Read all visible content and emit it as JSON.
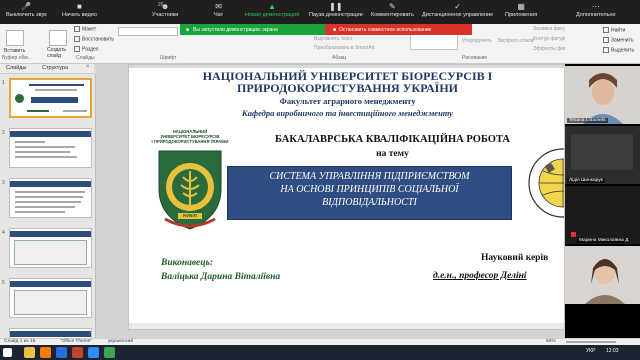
{
  "colors": {
    "zoom_bar": "#1f1f1f",
    "share_green": "#1aa33a",
    "share_red": "#d9322a",
    "slide_title_blue": "#1f3864",
    "topic_box": "#2f4d82",
    "executor_green": "#1f5d2c",
    "thumb_selected": "#e8a33b"
  },
  "zoom_toolbar": {
    "items": [
      {
        "label": "Выключить звук",
        "icon": "microphone-icon"
      },
      {
        "label": "Начать видео",
        "icon": "video-off-icon"
      },
      {
        "label": "Участники",
        "icon": "participants-icon"
      },
      {
        "label": "Чат",
        "icon": "chat-icon"
      },
      {
        "label": "Новая демонстрация",
        "icon": "share-screen-icon"
      },
      {
        "label": "Пауза демонстрации",
        "icon": "pause-icon"
      },
      {
        "label": "Комментировать",
        "icon": "annotate-icon"
      },
      {
        "label": "Дистанционное управление",
        "icon": "remote-control-icon"
      },
      {
        "label": "Приложения",
        "icon": "apps-icon"
      },
      {
        "label": "Дополнительно",
        "icon": "more-icon"
      }
    ],
    "participant_count": "26"
  },
  "share_banner": {
    "sharing_text": "Вы запустили демонстрацию экрана",
    "stop_text": "Остановить совместное использование"
  },
  "ribbon": {
    "clipboard": {
      "paste": "Вставить",
      "group": "Буфер обм..."
    },
    "slides": {
      "create": "Создать слайд",
      "layout": "Макет",
      "reset": "Восстановить",
      "section": "Раздел",
      "group": "Слайды"
    },
    "font": {
      "group": "Шрифт"
    },
    "paragraph": {
      "group": "Абзац",
      "text_direction": "Направление текста",
      "align_text": "Выровнять текст",
      "smartart": "Преобразовать в SmartArt"
    },
    "drawing": {
      "group": "Рисование",
      "arrange": "Упорядочить",
      "quick_styles": "Экспресс-стили"
    },
    "editing": {
      "find": "Найти",
      "replace": "Заменить",
      "select": "Выделить",
      "shape_fill": "Заливка фигуры",
      "shape_outline": "Контур фигуры",
      "shape_effects": "Эффекты фигуры"
    }
  },
  "panes": {
    "tab_slides": "Слайды",
    "tab_outline": "Структура",
    "close": "×",
    "slide_numbers": [
      "1",
      "2",
      "3",
      "4",
      "5"
    ]
  },
  "slide": {
    "university_line1": "НАЦІОНАЛЬНИЙ УНІВЕРСИТЕТ БІОРЕСУРСІВ І",
    "university_line2": "ПРИРОДОКОРИСТУВАННЯ УКРАЇНИ",
    "faculty": "Факультет аграрного менеджменту",
    "department": "Кафедра виробничого та інвестиційного  менеджменту",
    "work_type": "БАКАЛАВРСЬКА КВАЛІФІКАЦІЙНА РОБОТА",
    "on_topic": "на тему",
    "topic_line1": "СИСТЕМА УПРАВЛІННЯ ПІДПРИЄМСТВОМ",
    "topic_line2": "НА ОСНОВІ ПРИНЦИПІВ СОЦІАЛЬНОЇ",
    "topic_line3": "ВІДПОВІДАЛЬНОСТІ",
    "executor_label": "Виконавець:",
    "executor_name": "Валіцька Дарина Віталіївна",
    "supervisor_label": "Науковий керів",
    "supervisor_name": "д.е.н., професор Деліні",
    "logo_text_line1": "НАЦІОНАЛЬНИЙ",
    "logo_text_line2": "УНІВЕРСИТЕТ БІОРЕСУРСІВ",
    "logo_text_line3": "І ПРИРОДОКОРИСТУВАННЯ УКРАЇНИ",
    "logo_abbr": "НУБіП"
  },
  "participants": [
    {
      "name": "Tetiana Lobunets"
    },
    {
      "name": "Лідія Шинкарук"
    },
    {
      "name": "Марина Миколаївна Д"
    },
    {
      "name": ""
    }
  ],
  "status_bar": {
    "slide_info": "Слайд 1 из 16",
    "theme": "\"Office Theme\"",
    "language": "украинский",
    "zoom": "60%"
  },
  "taskbar": {
    "time": "12:03",
    "language": "УКР"
  }
}
